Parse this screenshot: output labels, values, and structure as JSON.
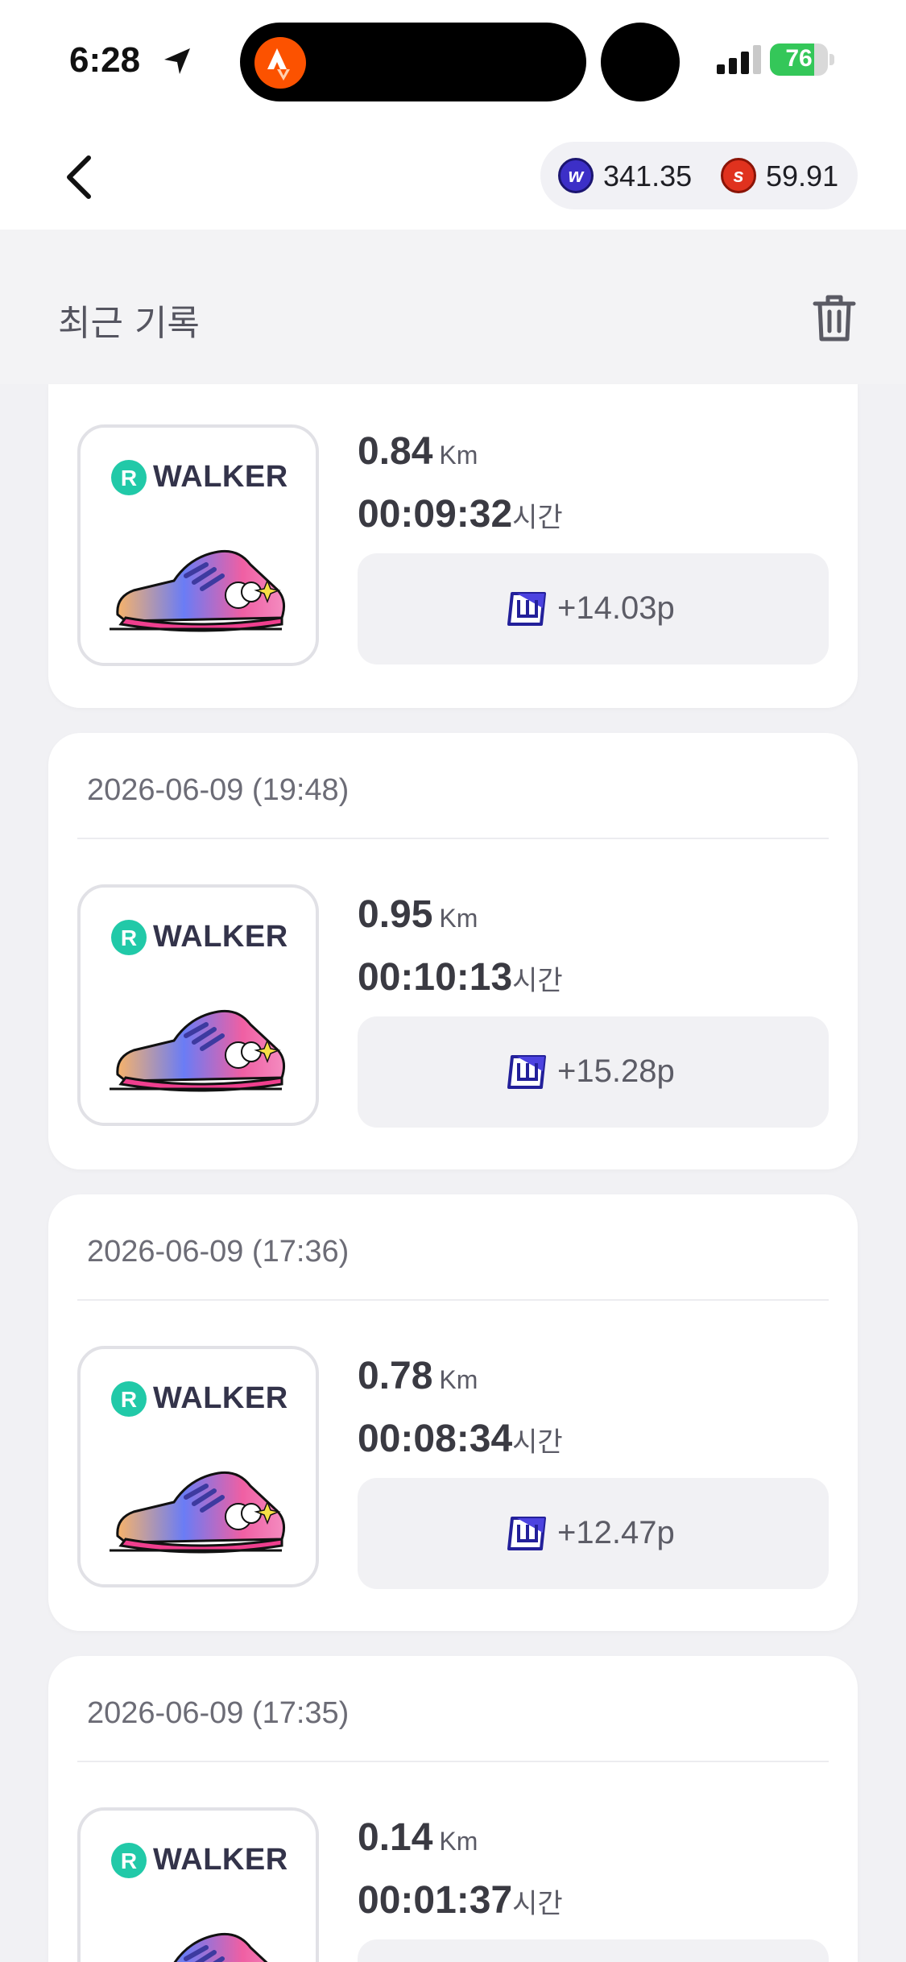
{
  "status": {
    "time": "6:28",
    "battery": "76",
    "battery_level": 0.76
  },
  "header": {
    "back_label": "",
    "balances": [
      {
        "coin": "W",
        "value": "341.35",
        "color": "#3c2fc7"
      },
      {
        "coin": "S",
        "value": "59.91",
        "color": "#e0321e"
      }
    ]
  },
  "section": {
    "title": "최근 기록"
  },
  "records": [
    {
      "date": "",
      "brand": "WALKER",
      "brand_badge": "R",
      "distance": "0.84",
      "distance_unit": "Km",
      "duration": "00:09:32",
      "duration_unit": "시간",
      "reward": "+14.03p"
    },
    {
      "date": "2026-06-09 (19:48)",
      "brand": "WALKER",
      "brand_badge": "R",
      "distance": "0.95",
      "distance_unit": "Km",
      "duration": "00:10:13",
      "duration_unit": "시간",
      "reward": "+15.28p"
    },
    {
      "date": "2026-06-09 (17:36)",
      "brand": "WALKER",
      "brand_badge": "R",
      "distance": "0.78",
      "distance_unit": "Km",
      "duration": "00:08:34",
      "duration_unit": "시간",
      "reward": "+12.47p"
    },
    {
      "date": "2026-06-09 (17:35)",
      "brand": "WALKER",
      "brand_badge": "R",
      "distance": "0.14",
      "distance_unit": "Km",
      "duration": "00:01:37",
      "duration_unit": "시간",
      "reward": ""
    }
  ]
}
